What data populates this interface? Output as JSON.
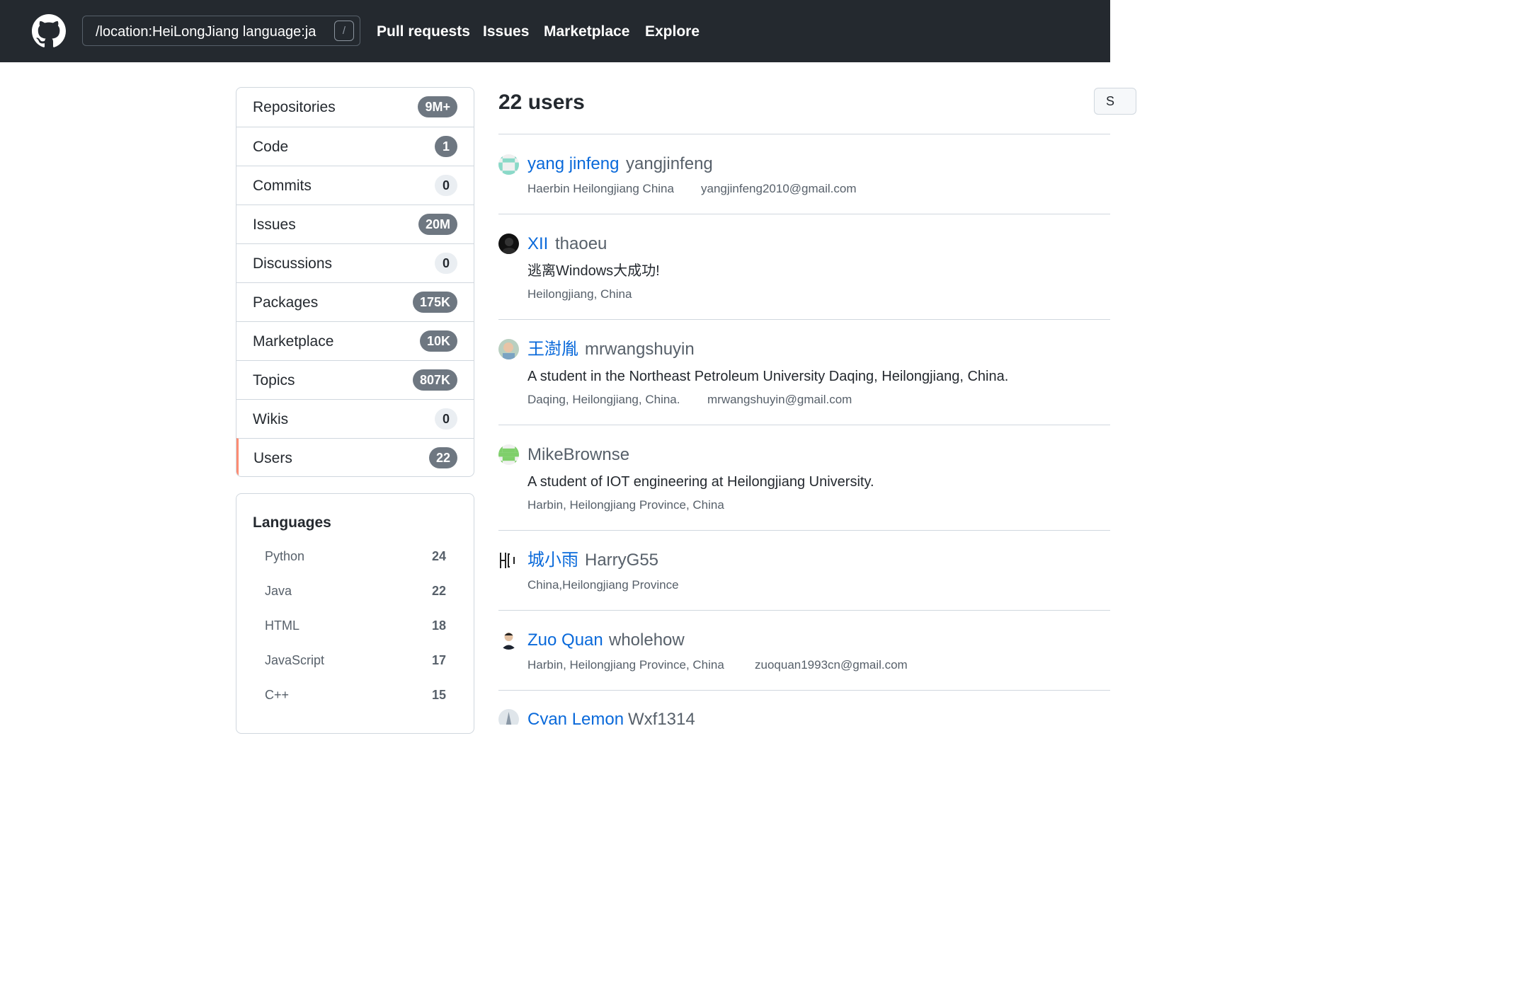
{
  "header": {
    "search_query": "/location:HeiLongJiang language:ja",
    "slash_key": "/",
    "nav": [
      "Pull requests",
      "Issues",
      "Marketplace",
      "Explore"
    ]
  },
  "filters": [
    {
      "label": "Repositories",
      "count": "9M+"
    },
    {
      "label": "Code",
      "count": "1"
    },
    {
      "label": "Commits",
      "count": "0"
    },
    {
      "label": "Issues",
      "count": "20M"
    },
    {
      "label": "Discussions",
      "count": "0"
    },
    {
      "label": "Packages",
      "count": "175K"
    },
    {
      "label": "Marketplace",
      "count": "10K"
    },
    {
      "label": "Topics",
      "count": "807K"
    },
    {
      "label": "Wikis",
      "count": "0"
    },
    {
      "label": "Users",
      "count": "22"
    }
  ],
  "selected_filter": "Users",
  "languages": {
    "title": "Languages",
    "items": [
      {
        "name": "Python",
        "count": "24"
      },
      {
        "name": "Java",
        "count": "22"
      },
      {
        "name": "HTML",
        "count": "18"
      },
      {
        "name": "JavaScript",
        "count": "17"
      },
      {
        "name": "C++",
        "count": "15"
      }
    ]
  },
  "results": {
    "title": "22 users",
    "sort_label": "S",
    "users": [
      {
        "name": "yang jinfeng",
        "login": "yangjinfeng",
        "bio": "",
        "location": "Haerbin Heilongjiang China",
        "email": "yangjinfeng2010@gmail.com",
        "avatar": "identicon-teal-avatar"
      },
      {
        "name": "XII",
        "login": "thaoeu",
        "bio": "逃离Windows大成功!",
        "location": "Heilongjiang, China",
        "email": "",
        "avatar": "dark-photo-avatar"
      },
      {
        "name": "王澍胤",
        "login": "mrwangshuyin",
        "bio": "A student in the Northeast Petroleum University Daqing, Heilongjiang, China.",
        "location": "Daqing, Heilongjiang, China.",
        "email": "mrwangshuyin@gmail.com",
        "avatar": "child-photo-avatar"
      },
      {
        "name": "",
        "login": "MikeBrownse",
        "bio": "A student of IOT engineering at Heilongjiang University.",
        "location": "Harbin, Heilongjiang Province, China",
        "email": "",
        "avatar": "identicon-green-avatar"
      },
      {
        "name": "城小雨",
        "login": "HarryG55",
        "bio": "",
        "location": "China,Heilongjiang Province",
        "email": "",
        "avatar": "hc-logo-avatar"
      },
      {
        "name": "Zuo Quan",
        "login": "wholehow",
        "bio": "",
        "location": "Harbin, Heilongjiang Province, China",
        "email": "zuoquan1993cn@gmail.com",
        "avatar": "portrait-photo-avatar"
      },
      {
        "name": "Cyan Lemon",
        "login": "Wxf1314",
        "bio": "",
        "location": "",
        "email": "",
        "avatar": "figure-photo-avatar"
      }
    ]
  },
  "colors": {
    "header_bg": "#24292f",
    "link": "#0969da",
    "selected_accent": "#fd8c73",
    "counter_bg": "#6e7781"
  }
}
